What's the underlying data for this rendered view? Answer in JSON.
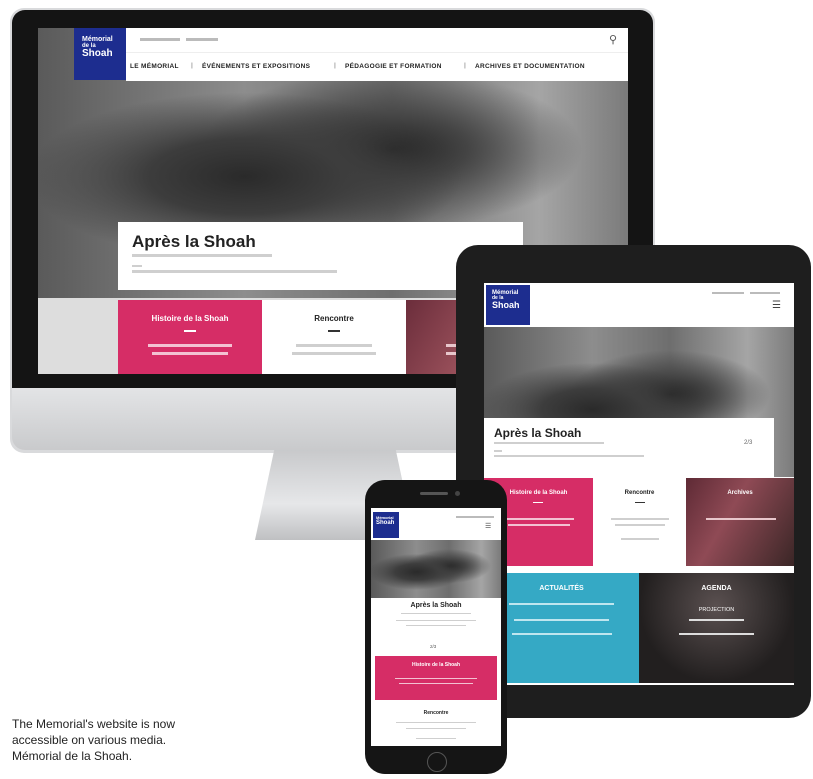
{
  "caption": {
    "line1": "The Memorial's website is now",
    "line2": "accessible on various media.",
    "line3": "Mémorial de la Shoah."
  },
  "site": {
    "logo_line1": "Mémorial",
    "logo_line2": "de la",
    "logo_line3": "Shoah",
    "nav": [
      "LE MÉMORIAL",
      "ÉVÉNEMENTS ET EXPOSITIONS",
      "PÉDAGOGIE ET FORMATION",
      "ARCHIVES ET DOCUMENTATION"
    ],
    "nav_sep": "|",
    "hero_title": "Après la Shoah",
    "tiles": {
      "histoire": "Histoire de la Shoah",
      "rencontre": "Rencontre",
      "archives": "Archives"
    },
    "actualites": "ACTUALITÉS",
    "agenda": "AGENDA",
    "projection": "PROJECTION",
    "pagination": "2/3"
  },
  "icons": {
    "search": "search-icon",
    "menu": "hamburger-menu-icon"
  },
  "colors": {
    "brand_blue": "#1d2d8f",
    "pink": "#d62d66",
    "teal": "#35a9c5"
  }
}
